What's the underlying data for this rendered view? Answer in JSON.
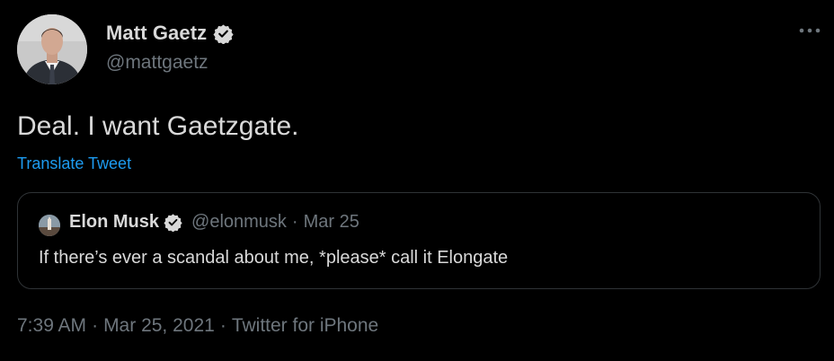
{
  "author": {
    "name": "Matt Gaetz",
    "handle": "@mattgaetz",
    "verified": true,
    "avatar_icon": "profile-photo"
  },
  "more_icon": "more-horizontal-icon",
  "tweet": {
    "text": "Deal. I want Gaetzgate.",
    "translate_label": "Translate Tweet"
  },
  "quoted_tweet": {
    "name": "Elon Musk",
    "handle": "@elonmusk",
    "separator": "·",
    "date": "Mar 25",
    "text": "If there’s ever a scandal about me, *please* call it Elongate",
    "verified": true
  },
  "meta": {
    "time": "7:39 AM",
    "separator": "·",
    "date": "Mar 25, 2021",
    "source": "Twitter for iPhone"
  },
  "colors": {
    "background": "#000000",
    "text": "#d9d9d9",
    "secondary": "#6e767d",
    "link": "#1d9bf0",
    "border": "#2f3336"
  }
}
